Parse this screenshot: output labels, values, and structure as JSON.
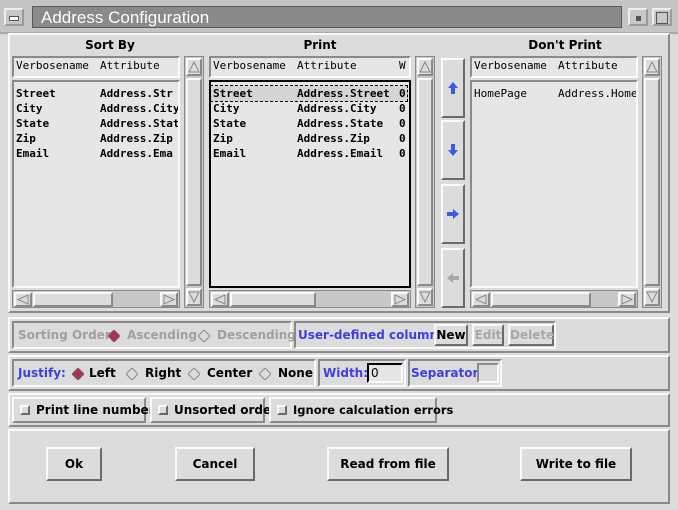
{
  "window": {
    "title": "Address Configuration"
  },
  "sort_by": {
    "heading": "Sort By",
    "columns": [
      "Verbosename",
      "Attribute"
    ],
    "rows": [
      {
        "name": "Street",
        "attr": "Address.Str"
      },
      {
        "name": "City",
        "attr": "Address.City"
      },
      {
        "name": "State",
        "attr": "Address.Stat"
      },
      {
        "name": "Zip",
        "attr": "Address.Zip"
      },
      {
        "name": "Email",
        "attr": "Address.Ema"
      }
    ]
  },
  "print": {
    "heading": "Print",
    "columns": [
      "Verbosename",
      "Attribute",
      "W"
    ],
    "rows": [
      {
        "name": "Street",
        "attr": "Address.Street",
        "w": "0"
      },
      {
        "name": "City",
        "attr": "Address.City",
        "w": "0"
      },
      {
        "name": "State",
        "attr": "Address.State",
        "w": "0"
      },
      {
        "name": "Zip",
        "attr": "Address.Zip",
        "w": "0"
      },
      {
        "name": "Email",
        "attr": "Address.Email",
        "w": "0"
      }
    ]
  },
  "dont_print": {
    "heading": "Don't Print",
    "columns": [
      "Verbosename",
      "Attribute"
    ],
    "rows": [
      {
        "name": "HomePage",
        "attr": "Address.Home"
      }
    ]
  },
  "sorting": {
    "label": "Sorting Order:",
    "ascending": "Ascending",
    "descending": "Descending",
    "selected": "Ascending"
  },
  "user_columns": {
    "label": "User-defined columns:",
    "new": "New",
    "edit": "Edit",
    "delete": "Delete"
  },
  "justify": {
    "label": "Justify:",
    "options": [
      "Left",
      "Right",
      "Center",
      "None"
    ],
    "selected": "Left"
  },
  "width": {
    "label": "Width:",
    "value": "0"
  },
  "separator": {
    "label": "Separator:",
    "value": ""
  },
  "checkboxes": {
    "line_numbers": "Print line numbers",
    "unsorted": "Unsorted order",
    "ignore_errors": "Ignore calculation errors"
  },
  "buttons": {
    "ok": "Ok",
    "cancel": "Cancel",
    "read": "Read from file",
    "write": "Write to file"
  },
  "colors": {
    "accent": "#4040e0",
    "arrow": "#3a5ae8",
    "radio_on": "#b03050"
  }
}
